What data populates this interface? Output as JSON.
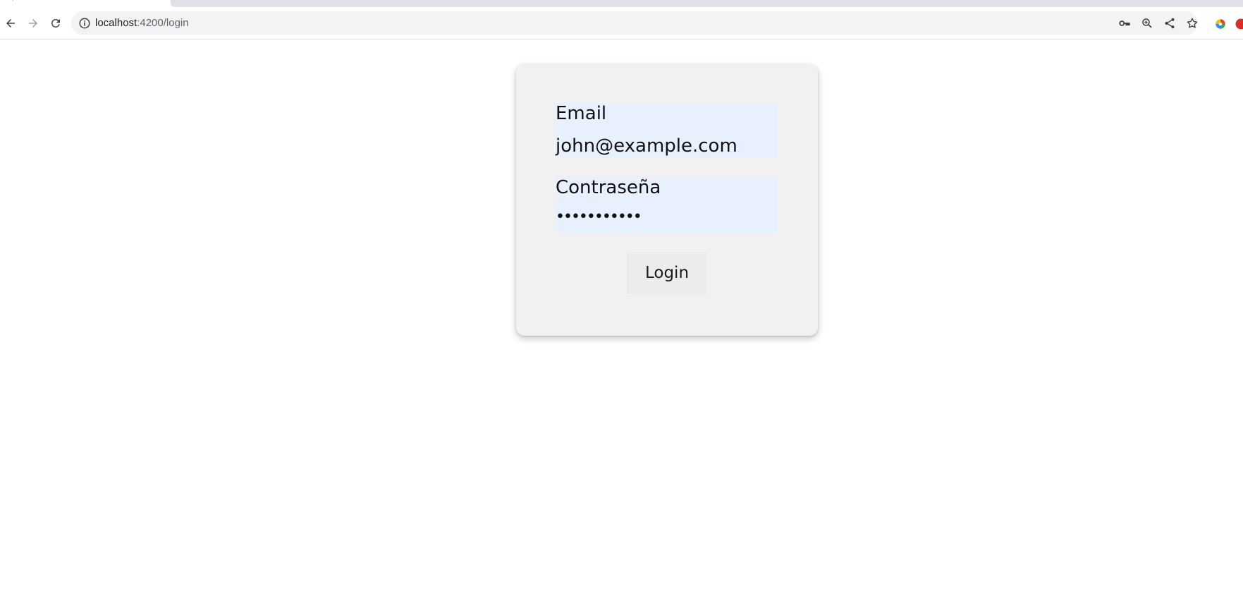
{
  "browser": {
    "url_host": "localhost",
    "url_path": ":4200/login",
    "icons": {
      "back": "arrow-left-icon",
      "forward": "arrow-right-icon",
      "reload": "reload-icon",
      "site_info": "info-icon",
      "password": "key-icon",
      "zoom": "zoom-in-icon",
      "share": "share-icon",
      "bookmark": "star-icon"
    }
  },
  "login_form": {
    "email_label": "Email",
    "email_value": "john@example.com",
    "password_label": "Contraseña",
    "password_mask": "•••••••••••",
    "submit_label": "Login"
  },
  "colors": {
    "card_background": "#f1f1f1",
    "autofill_background": "#e8f0fe",
    "button_background": "#ececec"
  }
}
